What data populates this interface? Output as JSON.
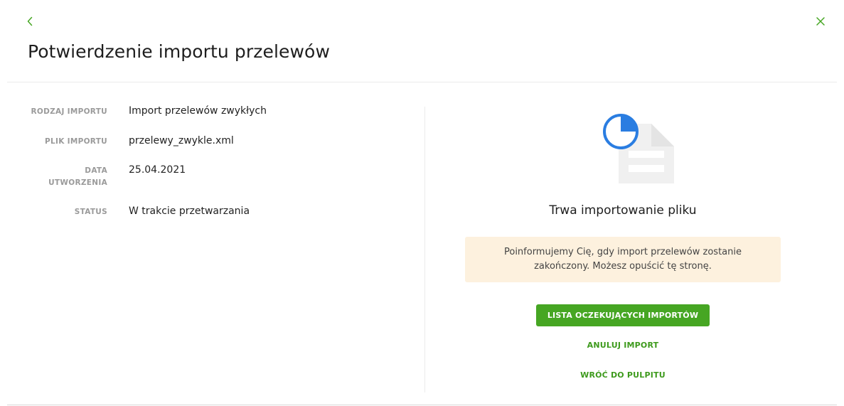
{
  "header": {
    "title": "Potwierdzenie importu przelewów",
    "back_icon": "chevron-left-icon",
    "close_icon": "close-icon",
    "accent_color": "#46a623"
  },
  "details": [
    {
      "label": "RODZAJ IMPORTU",
      "value": "Import przelewów zwykłych"
    },
    {
      "label": "PLIK IMPORTU",
      "value": "przelewy_zwykle.xml"
    },
    {
      "label": "DATA UTWORZENIA",
      "value": "25.04.2021"
    },
    {
      "label": "STATUS",
      "value": "W trakcie przetwarzania"
    }
  ],
  "status_panel": {
    "illustration_icon": "document-progress-icon",
    "progress_color": "#2a7de1",
    "title": "Trwa importowanie pliku",
    "info_message": "Poinformujemy Cię, gdy import przelewów zostanie zakończony. Możesz opuścić tę stronę.",
    "info_bg_color": "#fdf1de",
    "primary_button": "LISTA OCZEKUJĄCYCH IMPORTÓW",
    "cancel_link": "ANULUJ IMPORT",
    "dashboard_link": "WRÓĆ DO PULPITU"
  }
}
